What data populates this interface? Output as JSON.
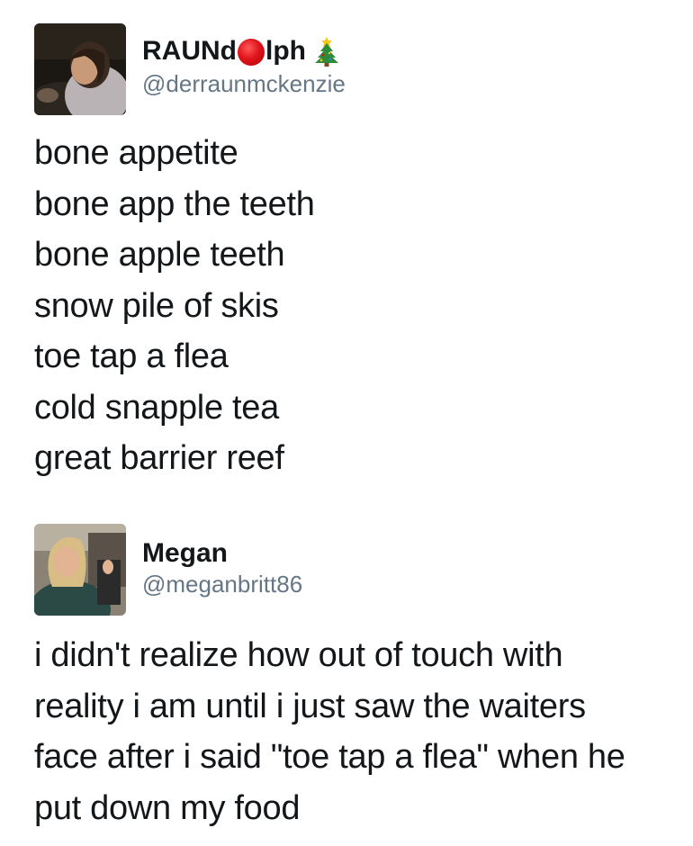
{
  "tweets": [
    {
      "author": {
        "name_before_dot": "RAUNd",
        "name_after_dot": "lph",
        "name_emoji": [
          "red-circle-icon",
          "christmas-tree-icon"
        ],
        "handle": "@derraunmckenzie"
      },
      "lines": [
        "bone appetite",
        "bone app the teeth",
        "bone apple teeth",
        "snow pile of skis",
        "toe tap a flea",
        "cold snapple tea",
        "great barrier reef"
      ]
    },
    {
      "author": {
        "name": "Megan",
        "handle": "@meganbritt86"
      },
      "lines": [
        "i didn't realize how out of touch with",
        "reality i am until i just saw the waiters",
        "face after i said \"toe tap a flea\" when he",
        "put down my food"
      ]
    }
  ],
  "colors": {
    "text": "#14171a",
    "handle": "#657786",
    "red_dot": "#e0141c",
    "tree": "#2e8b3a"
  }
}
